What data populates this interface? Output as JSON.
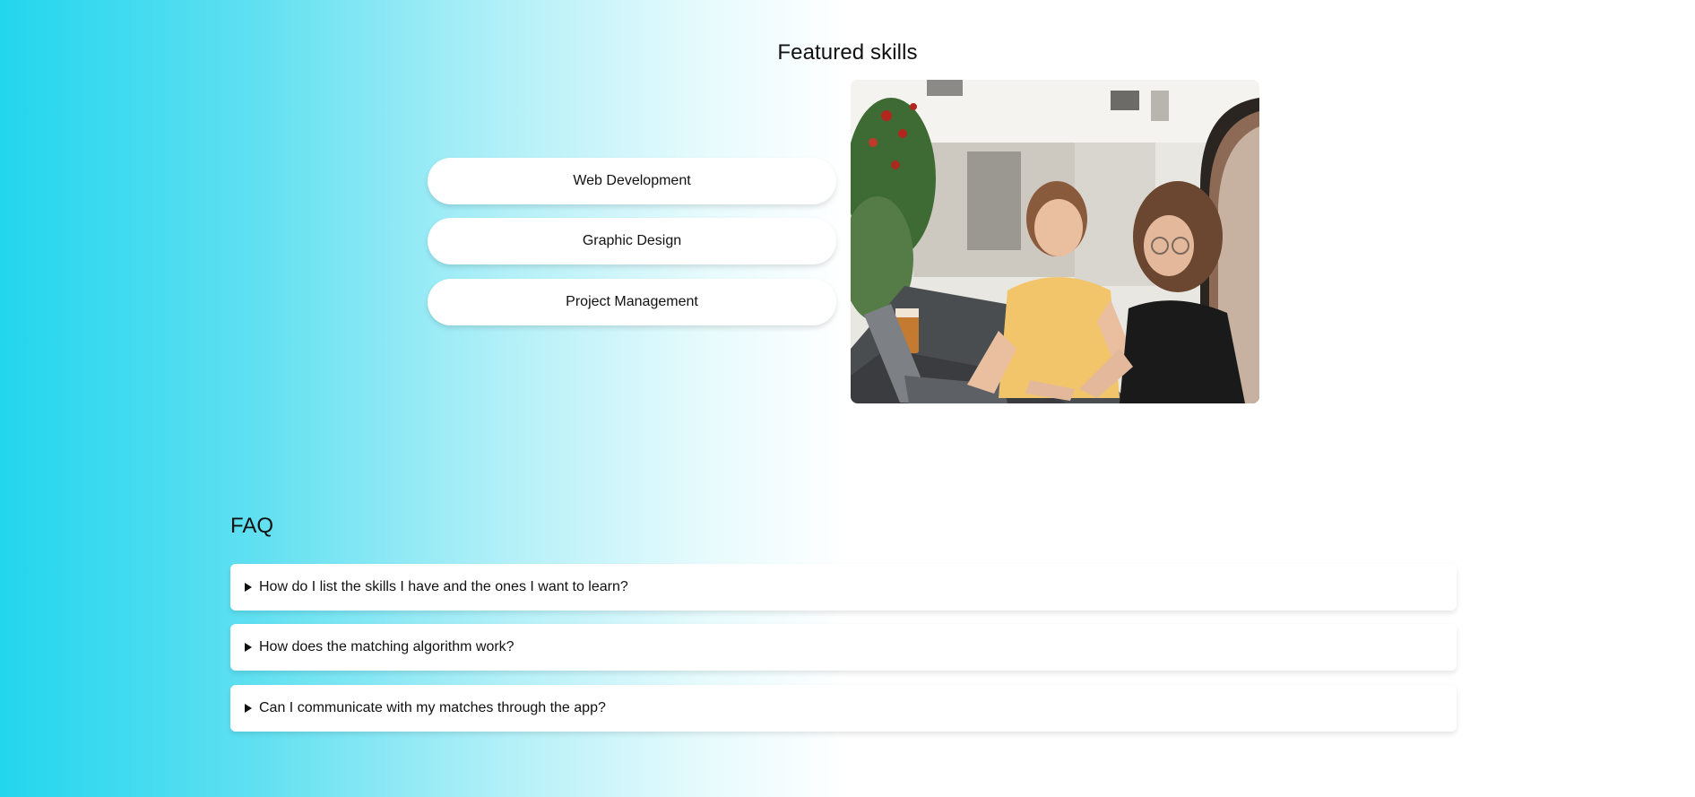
{
  "featured": {
    "title": "Featured skills",
    "skills": [
      {
        "label": "Web Development"
      },
      {
        "label": "Graphic Design"
      },
      {
        "label": "Project Management"
      }
    ],
    "photo": {
      "icon": "two-people-at-laptop-photo"
    }
  },
  "faq": {
    "title": "FAQ",
    "items": [
      {
        "question": "How do I list the skills I have and the ones I want to learn?"
      },
      {
        "question": "How does the matching algorithm work?"
      },
      {
        "question": "Can I communicate with my matches through the app?"
      }
    ]
  },
  "colors": {
    "gradient_start": "#22d6ee",
    "card_background": "#ffffff",
    "text": "#111111"
  }
}
